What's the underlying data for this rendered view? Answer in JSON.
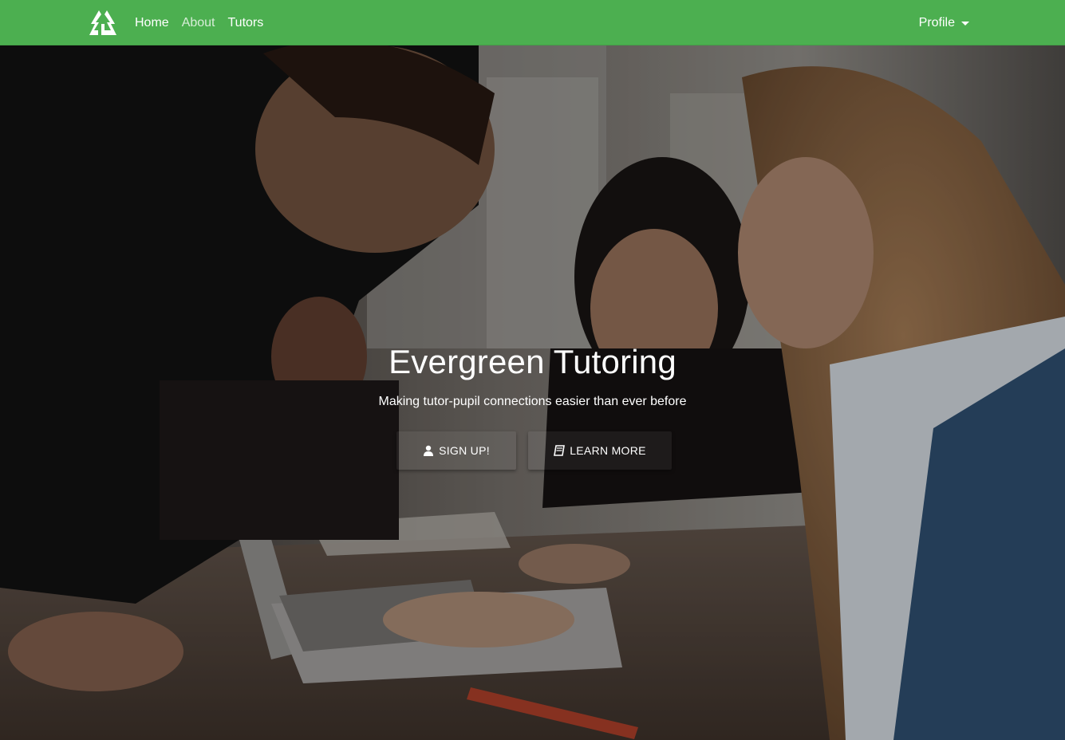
{
  "nav": {
    "brand_icon": "evergreen-logo-icon",
    "links": [
      {
        "label": "Home",
        "active": true
      },
      {
        "label": "About",
        "active": false
      },
      {
        "label": "Tutors",
        "active": true
      }
    ],
    "profile_label": "Profile",
    "bar_color": "#4caf50"
  },
  "hero": {
    "title": "Evergreen Tutoring",
    "subtitle": "Making tutor-pupil connections easier than ever before",
    "buttons": [
      {
        "label": "SIGN UP!",
        "icon": "user-icon"
      },
      {
        "label": "LEARN MORE",
        "icon": "book-icon"
      }
    ]
  }
}
